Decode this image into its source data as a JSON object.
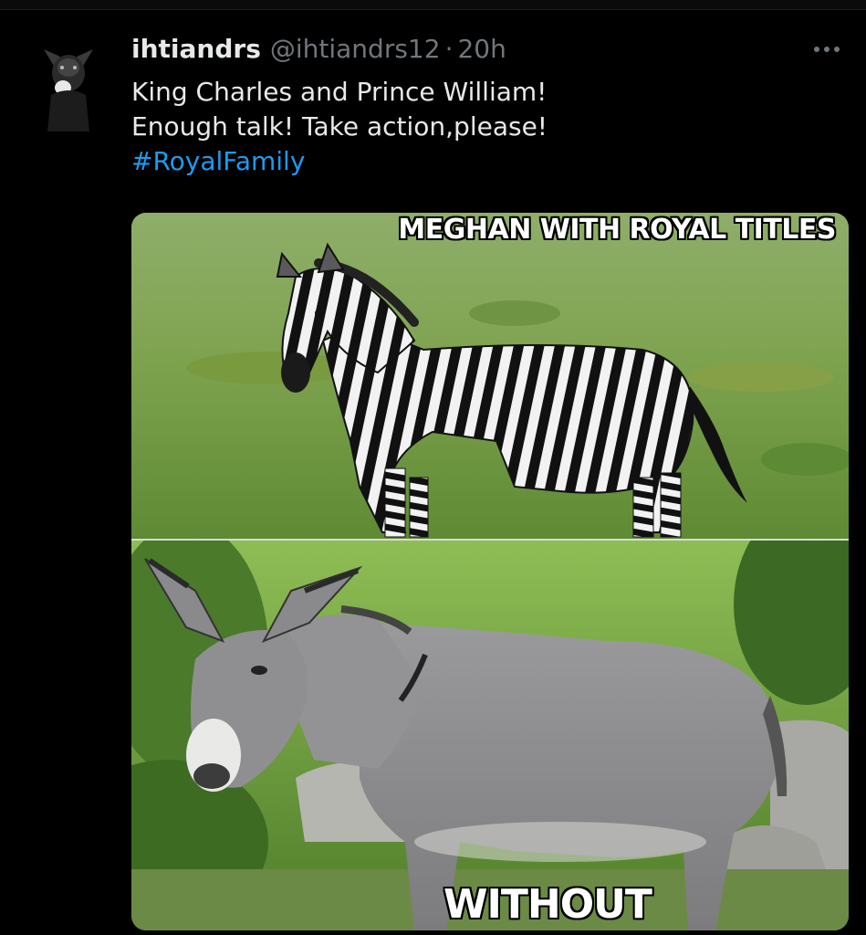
{
  "tweet": {
    "display_name": "ihtiandrs",
    "handle": "@ihtiandrs12",
    "separator": "·",
    "timestamp": "20h",
    "more_label": "···",
    "text_line_1": "King Charles and Prince William!",
    "text_line_2": "Enough talk! Take action,please!",
    "hashtag": "#RoyalFamily",
    "avatar_icon": "dog-avatar-icon"
  },
  "media": {
    "top_caption": "MEGHAN WITH ROYAL TITLES",
    "bottom_caption": "WITHOUT",
    "top_subject": "zebra",
    "bottom_subject": "donkey"
  },
  "colors": {
    "background": "#000000",
    "primary_text": "#e7e9ea",
    "secondary_text": "#71767b",
    "link": "#1d9bf0"
  }
}
